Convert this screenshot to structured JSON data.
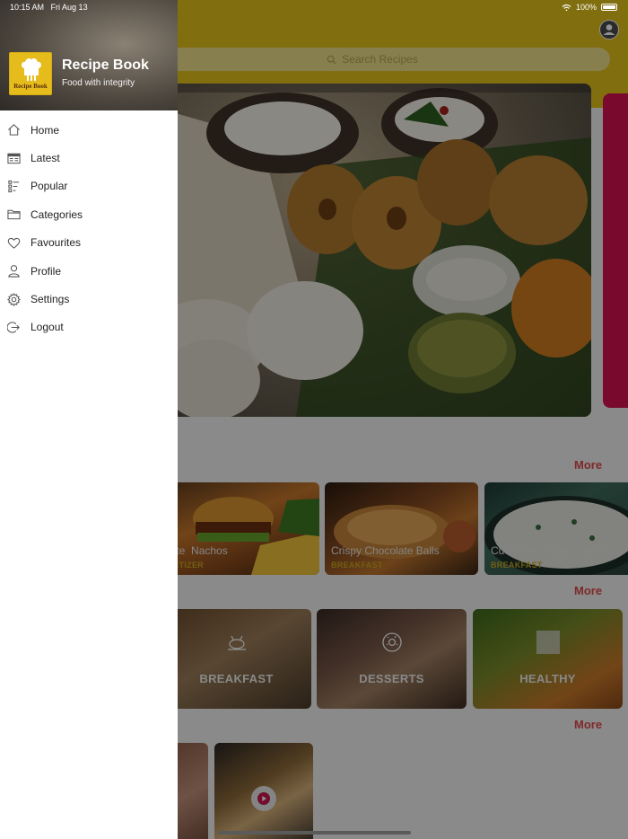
{
  "status_bar": {
    "time": "10:15 AM",
    "date": "Fri Aug 13",
    "battery": "100%"
  },
  "search": {
    "placeholder": "Search Recipes"
  },
  "sections": {
    "more_label": "More"
  },
  "recipes": [
    {
      "title": "Nachos",
      "title_prefix": "lote",
      "category": "PETIZER"
    },
    {
      "title": "Crispy Chocolate Balls",
      "category": "BREAKFAST"
    },
    {
      "title": "Cucumber Raita, Low Ca...",
      "category": "BREAKFAST"
    }
  ],
  "categories": [
    {
      "label": "BREAKFAST",
      "icon": "roast-chicken-icon"
    },
    {
      "label": "DESSERTS",
      "icon": "donut-icon"
    },
    {
      "label": "HEALTHY",
      "icon": "image-placeholder-icon"
    }
  ],
  "drawer": {
    "app_name": "Recipe Book",
    "tagline": "Food with integrity",
    "logo_text": "Recipe Book",
    "menu": [
      {
        "label": "Home",
        "icon": "home-icon"
      },
      {
        "label": "Latest",
        "icon": "newspaper-icon"
      },
      {
        "label": "Popular",
        "icon": "list-rank-icon"
      },
      {
        "label": "Categories",
        "icon": "folder-icon"
      },
      {
        "label": "Favourites",
        "icon": "heart-icon"
      },
      {
        "label": "Profile",
        "icon": "person-icon"
      },
      {
        "label": "Settings",
        "icon": "gear-icon"
      },
      {
        "label": "Logout",
        "icon": "logout-icon"
      }
    ]
  },
  "colors": {
    "accent": "#e2c21c",
    "more_link": "#e24848",
    "category_tag": "#c9a520"
  }
}
